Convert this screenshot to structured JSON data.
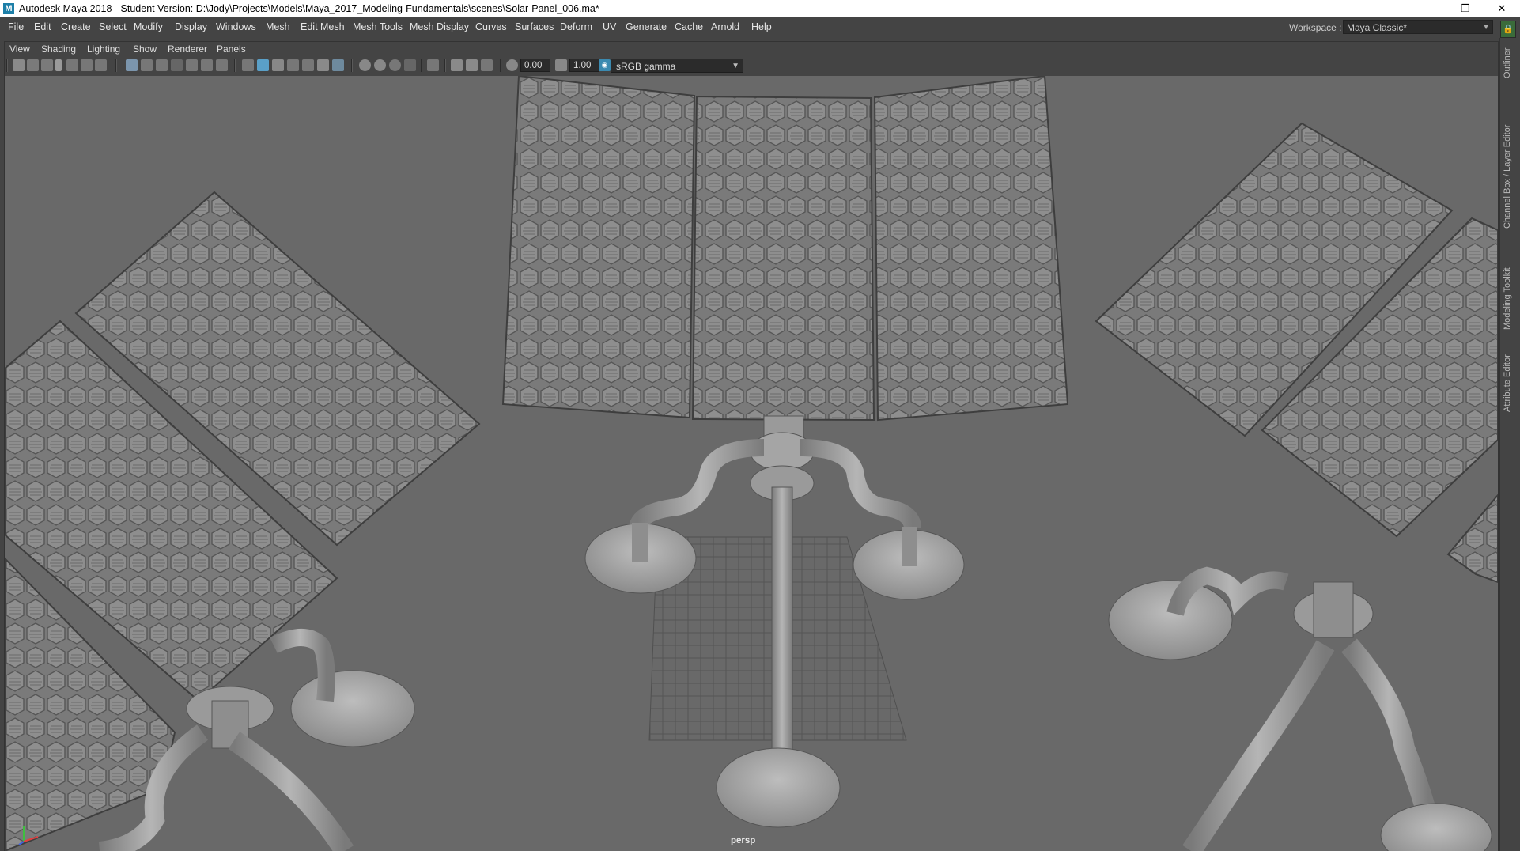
{
  "window": {
    "title": "Autodesk Maya 2018 - Student Version: D:\\Jody\\Projects\\Models\\Maya_2017_Modeling-Fundamentals\\scenes\\Solar-Panel_006.ma*",
    "app_icon": "M",
    "minimize": "–",
    "restore": "❐",
    "close": "✕"
  },
  "menubar": {
    "items": [
      "File",
      "Edit",
      "Create",
      "Select",
      "Modify",
      "Display",
      "Windows",
      "Mesh",
      "Edit Mesh",
      "Mesh Tools",
      "Mesh Display",
      "Curves",
      "Surfaces",
      "Deform",
      "UV",
      "Generate",
      "Cache",
      "Arnold",
      "Help"
    ]
  },
  "workspace": {
    "label": "Workspace :",
    "value": "Maya Classic*",
    "lock_icon": "lock-icon"
  },
  "panel_menu": {
    "items": [
      "View",
      "Shading",
      "Lighting",
      "Show",
      "Renderer",
      "Panels"
    ]
  },
  "toolbar": {
    "exposure": "0.00",
    "gamma": "1.00",
    "color_space": "sRGB gamma"
  },
  "viewport": {
    "camera": "persp",
    "background": "#696969",
    "grid_color": "#4a4a4a"
  },
  "sidebar": {
    "tabs": [
      "Outliner",
      "Channel Box / Layer Editor",
      "Modeling Toolkit",
      "Attribute Editor"
    ]
  }
}
